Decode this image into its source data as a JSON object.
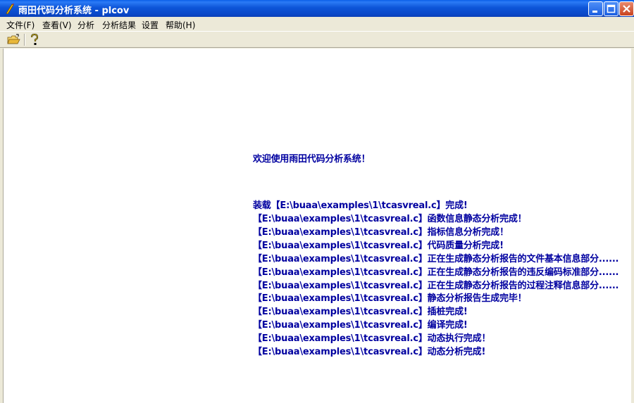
{
  "window": {
    "title": "雨田代码分析系统 - plcov"
  },
  "menu": [
    {
      "label": "文件(F)"
    },
    {
      "label": "查看(V)"
    },
    {
      "label": "分析"
    },
    {
      "label": "分析结果"
    },
    {
      "label": "设置"
    },
    {
      "label": "帮助(H)"
    }
  ],
  "toolbar": {
    "buttons": [
      {
        "icon": "open-folder-icon"
      },
      {
        "icon": "help-icon"
      }
    ]
  },
  "content": {
    "welcome": "欢迎使用雨田代码分析系统！",
    "log": [
      "装载【E:\\buaa\\examples\\1\\tcasvreal.c】完成!",
      "【E:\\buaa\\examples\\1\\tcasvreal.c】函数信息静态分析完成！",
      "【E:\\buaa\\examples\\1\\tcasvreal.c】指标信息分析完成！",
      "【E:\\buaa\\examples\\1\\tcasvreal.c】代码质量分析完成!",
      "【E:\\buaa\\examples\\1\\tcasvreal.c】正在生成静态分析报告的文件基本信息部分......",
      "【E:\\buaa\\examples\\1\\tcasvreal.c】正在生成静态分析报告的违反编码标准部分......",
      "【E:\\buaa\\examples\\1\\tcasvreal.c】正在生成静态分析报告的过程注释信息部分......",
      "【E:\\buaa\\examples\\1\\tcasvreal.c】静态分析报告生成完毕！",
      "【E:\\buaa\\examples\\1\\tcasvreal.c】插桩完成!",
      "【E:\\buaa\\examples\\1\\tcasvreal.c】编译完成!",
      "【E:\\buaa\\examples\\1\\tcasvreal.c】动态执行完成！",
      "【E:\\buaa\\examples\\1\\tcasvreal.c】动态分析完成!"
    ]
  },
  "colors": {
    "text": "#0000a0",
    "titlebar": "#0a55d8"
  }
}
